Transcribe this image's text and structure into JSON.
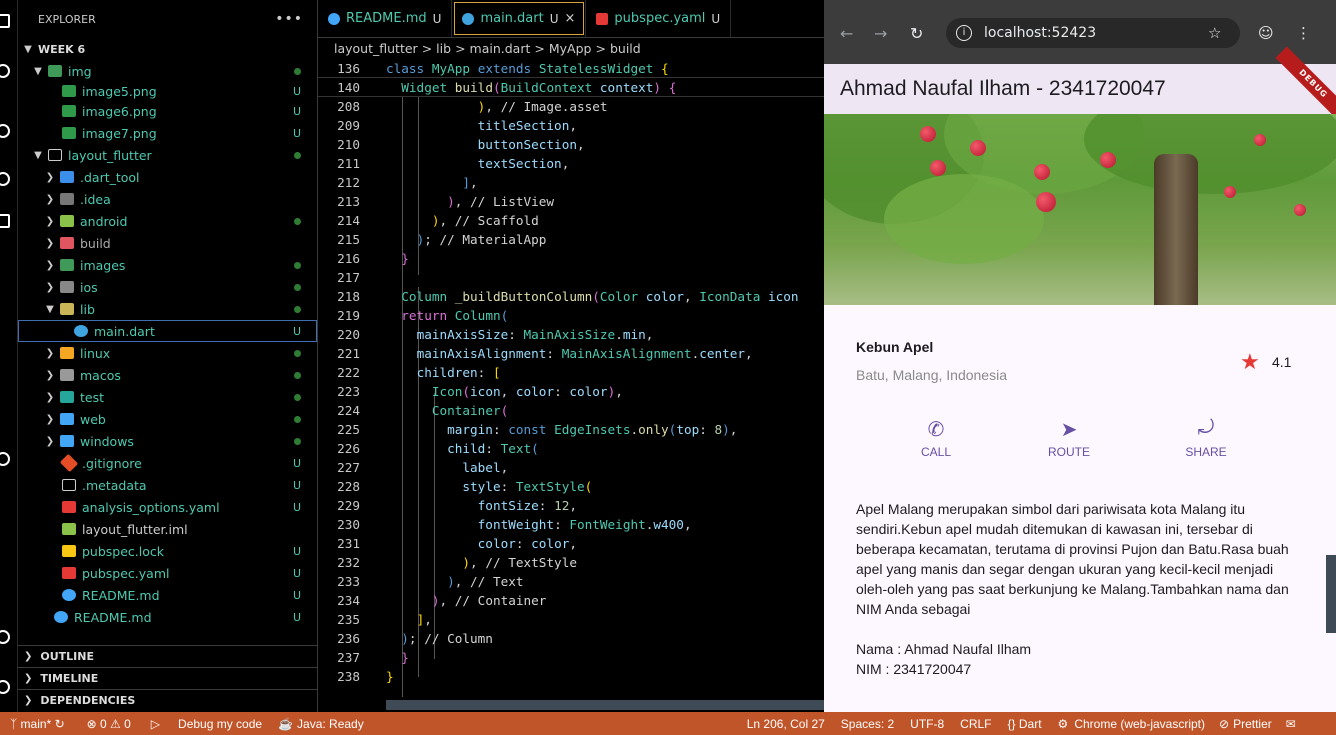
{
  "explorer": {
    "title": "EXPLORER",
    "more": "•••",
    "root": "WEEK 6",
    "items": [
      {
        "label": "img",
        "status": "dot",
        "color": "#4ec9b0",
        "icon": "folder-icon"
      },
      {
        "label": "image5.png",
        "status": "U",
        "icon": "image-file-icon"
      },
      {
        "label": "image6.png",
        "status": "U",
        "icon": "image-file-icon"
      },
      {
        "label": "image7.png",
        "status": "U",
        "icon": "image-file-icon"
      },
      {
        "label": "layout_flutter",
        "status": "dot",
        "icon": "folder-icon"
      },
      {
        "label": ".dart_tool",
        "status": "",
        "icon": "folder-icon"
      },
      {
        "label": ".idea",
        "status": "",
        "icon": "folder-icon"
      },
      {
        "label": "android",
        "status": "dot",
        "icon": "folder-icon"
      },
      {
        "label": "build",
        "status": "",
        "icon": "folder-icon"
      },
      {
        "label": "images",
        "status": "dot",
        "icon": "folder-icon"
      },
      {
        "label": "ios",
        "status": "dot",
        "icon": "folder-icon"
      },
      {
        "label": "lib",
        "status": "dot",
        "icon": "folder-icon"
      },
      {
        "label": "main.dart",
        "status": "U",
        "icon": "dart-file-icon"
      },
      {
        "label": "linux",
        "status": "dot",
        "icon": "folder-icon"
      },
      {
        "label": "macos",
        "status": "dot",
        "icon": "folder-icon"
      },
      {
        "label": "test",
        "status": "dot",
        "icon": "folder-icon"
      },
      {
        "label": "web",
        "status": "dot",
        "icon": "folder-icon"
      },
      {
        "label": "windows",
        "status": "dot",
        "icon": "folder-icon"
      },
      {
        "label": ".gitignore",
        "status": "U",
        "icon": "git-file-icon"
      },
      {
        "label": ".metadata",
        "status": "U",
        "icon": "file-icon"
      },
      {
        "label": "analysis_options.yaml",
        "status": "U",
        "icon": "yaml-file-icon"
      },
      {
        "label": "layout_flutter.iml",
        "status": "",
        "icon": "iml-file-icon"
      },
      {
        "label": "pubspec.lock",
        "status": "U",
        "icon": "lock-file-icon"
      },
      {
        "label": "pubspec.yaml",
        "status": "U",
        "icon": "yaml-file-icon"
      },
      {
        "label": "README.md",
        "status": "U",
        "icon": "info-file-icon"
      },
      {
        "label": "README.md",
        "status": "U",
        "icon": "info-file-icon"
      }
    ],
    "outline": "OUTLINE",
    "timeline": "TIMELINE",
    "dependencies": "DEPENDENCIES"
  },
  "editor": {
    "tabs": [
      {
        "label": "README.md",
        "mark": "U",
        "icon": "info-icon"
      },
      {
        "label": "main.dart",
        "mark": "U",
        "close": "×",
        "icon": "dart-icon"
      },
      {
        "label": "pubspec.yaml",
        "mark": "U",
        "icon": "yaml-icon"
      }
    ],
    "breadcrumbs": [
      "layout_flutter",
      ">",
      "lib",
      ">",
      "main.dart",
      ">",
      "MyApp",
      ">",
      "build"
    ],
    "line_numbers": [
      "136",
      "140",
      "208",
      "209",
      "210",
      "211",
      "212",
      "213",
      "214",
      "215",
      "216",
      "217",
      "218",
      "219",
      "220",
      "221",
      "222",
      "223",
      "224",
      "225",
      "226",
      "227",
      "228",
      "229",
      "230",
      "231",
      "232",
      "233",
      "234",
      "235",
      "236",
      "237",
      "238"
    ]
  },
  "browser": {
    "url": "localhost:52423",
    "app_title": "Ahmad Naufal Ilham - 2341720047",
    "debug": "DEBUG",
    "place_title": "Kebun Apel",
    "place_location": "Batu, Malang, Indonesia",
    "rating": "4.1",
    "buttons": [
      {
        "label": "CALL",
        "icon": "phone-icon"
      },
      {
        "label": "ROUTE",
        "icon": "navigation-icon"
      },
      {
        "label": "SHARE",
        "icon": "share-icon"
      }
    ],
    "description": "Apel Malang merupakan simbol dari pariwisata kota Malang itu sendiri.Kebun apel mudah ditemukan di kawasan ini, tersebar di beberapa kecamatan, terutama di provinsi Pujon dan Batu.Rasa buah apel yang manis dan segar dengan ukuran yang kecil-kecil menjadi oleh-oleh yang pas saat berkunjung ke Malang.Tambahkan nama dan NIM Anda sebagai",
    "nama": "Nama : Ahmad Naufal Ilham",
    "nim": "NIM : 2341720047",
    "accent": "#6750a4"
  },
  "statusbar": {
    "branch": "main*",
    "problems": "⊗ 0 ⚠ 0",
    "debug": "Debug my code",
    "java": "Java: Ready",
    "position": "Ln 206, Col 27",
    "spaces": "Spaces: 2",
    "encoding": "UTF-8",
    "eol": "CRLF",
    "language": "{} Dart",
    "device": "Chrome (web-javascript)",
    "prettier": "Prettier",
    "color": "#c1552a"
  }
}
